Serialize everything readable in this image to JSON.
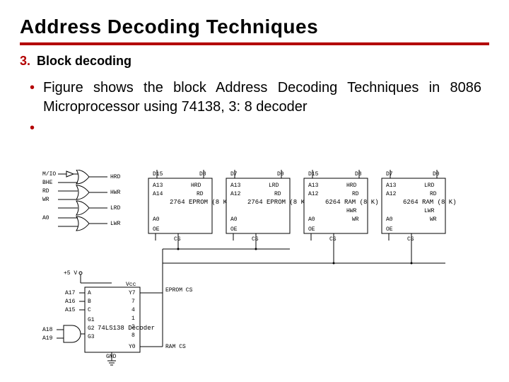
{
  "title": "Address Decoding Techniques",
  "section": {
    "number": "3.",
    "name": "Block decoding"
  },
  "bullet_text": "Figure shows the block Address Decoding Techniques in 8086 Microprocessor using 74138, 3: 8 decoder",
  "diagram": {
    "ctrl_in": [
      "M/IO",
      "BHE",
      "RD",
      "WR",
      "A0"
    ],
    "ctrl_out": [
      "HRD",
      "HWR",
      "LRD",
      "LWR"
    ],
    "chips": [
      {
        "name": "2764 EPROM (8 K)",
        "data": [
          "D15",
          "D8"
        ],
        "addr": [
          "A13",
          "A14",
          "A0"
        ],
        "rd": "HRD"
      },
      {
        "name": "2764 EPROM (8 K)",
        "data": [
          "D7",
          "D0"
        ],
        "addr": [
          "A13",
          "A12",
          "A0"
        ],
        "rd": "LRD"
      },
      {
        "name": "6264 RAM (8 K)",
        "data": [
          "D15",
          "D8"
        ],
        "addr": [
          "A13",
          "A12",
          "A0"
        ],
        "rd": "HRD",
        "wr": "HWR"
      },
      {
        "name": "6264 RAM (8 K)",
        "data": [
          "D7",
          "D0"
        ],
        "addr": [
          "A13",
          "A12",
          "A0"
        ],
        "rd": "LRD",
        "wr": "LWR"
      }
    ],
    "decoder": {
      "name": "74LS138 Decoder",
      "power": "+5 V",
      "inputs": [
        "A17",
        "A16",
        "A15"
      ],
      "pins_left": [
        "A",
        "B",
        "C",
        "G1",
        "G2",
        "G3"
      ],
      "pins_right_top": "Vcc",
      "pins_right": [
        "Y7",
        "7",
        "4",
        "1",
        "2",
        "8",
        "",
        "Y0"
      ],
      "gnd": "GND",
      "gate_in": [
        "A18",
        "A19"
      ],
      "out_top": "EPROM CS",
      "out_bot": "RAM CS"
    }
  }
}
